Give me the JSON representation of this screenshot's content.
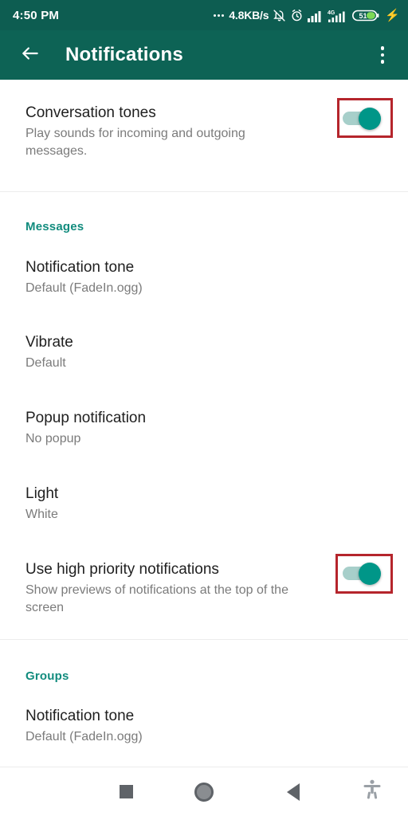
{
  "status_bar": {
    "clock": "4:50 PM",
    "network_speed": "4.8KB/s",
    "icons": [
      "ellipsis-icon",
      "bell-muted-icon",
      "alarm-clock-icon",
      "signal-bars-icon",
      "signal-bars-4g-icon",
      "battery-icon",
      "charging-bolt-icon"
    ],
    "mobile_network_label": "4G",
    "battery_percent": "51",
    "charging_glyph": "⚡"
  },
  "app_bar": {
    "back_icon": "arrow-left-icon",
    "title": "Notifications",
    "overflow_icon": "more-vertical-icon",
    "background_color": "#0d6355"
  },
  "theme": {
    "accent": "#128c7e",
    "toggle_on": "#009688",
    "toggle_track": "#a7cfca",
    "annotation": "#b5252c",
    "title_color": "#1f1f1f",
    "subtitle_color": "#7b7b7b"
  },
  "settings": [
    {
      "name": "conversation-tones",
      "title": "Conversation tones",
      "subtitle": "Play sounds for incoming and outgoing messages.",
      "control": "toggle",
      "value": "on",
      "annotated": true
    }
  ],
  "sections": [
    {
      "name": "messages",
      "header": "Messages",
      "items": [
        {
          "name": "notification-tone",
          "title": "Notification tone",
          "subtitle": "Default (FadeIn.ogg)",
          "control": "none"
        },
        {
          "name": "vibrate",
          "title": "Vibrate",
          "subtitle": "Default",
          "control": "none"
        },
        {
          "name": "popup-notification",
          "title": "Popup notification",
          "subtitle": "No popup",
          "control": "none"
        },
        {
          "name": "light",
          "title": "Light",
          "subtitle": "White",
          "control": "none"
        },
        {
          "name": "use-high-priority-notifications",
          "title": "Use high priority notifications",
          "subtitle": "Show previews of notifications at the top of the screen",
          "control": "toggle",
          "value": "on",
          "annotated": true
        }
      ]
    },
    {
      "name": "groups",
      "header": "Groups",
      "items": [
        {
          "name": "group-notification-tone",
          "title": "Notification tone",
          "subtitle": "Default (FadeIn.ogg)",
          "control": "none"
        }
      ]
    }
  ],
  "nav_bar": {
    "buttons": [
      {
        "name": "recents-button",
        "icon": "square-icon"
      },
      {
        "name": "home-button",
        "icon": "circle-icon"
      },
      {
        "name": "back-button",
        "icon": "triangle-left-icon"
      },
      {
        "name": "accessibility-button",
        "icon": "accessibility-icon"
      }
    ]
  }
}
